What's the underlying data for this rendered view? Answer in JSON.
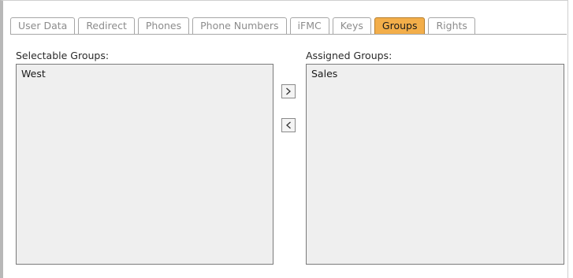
{
  "tabs": [
    {
      "label": "User Data",
      "active": false
    },
    {
      "label": "Redirect",
      "active": false
    },
    {
      "label": "Phones",
      "active": false
    },
    {
      "label": "Phone Numbers",
      "active": false
    },
    {
      "label": "iFMC",
      "active": false
    },
    {
      "label": "Keys",
      "active": false
    },
    {
      "label": "Groups",
      "active": true
    },
    {
      "label": "Rights",
      "active": false
    }
  ],
  "selectable": {
    "label": "Selectable Groups:",
    "items": [
      "West"
    ]
  },
  "assigned": {
    "label": "Assigned Groups:",
    "items": [
      "Sales"
    ]
  },
  "buttons": {
    "add_icon": "chevron-right-icon",
    "remove_icon": "chevron-left-icon"
  },
  "colors": {
    "active_tab": "#f3ae4a",
    "listbox_bg": "#efefef"
  }
}
